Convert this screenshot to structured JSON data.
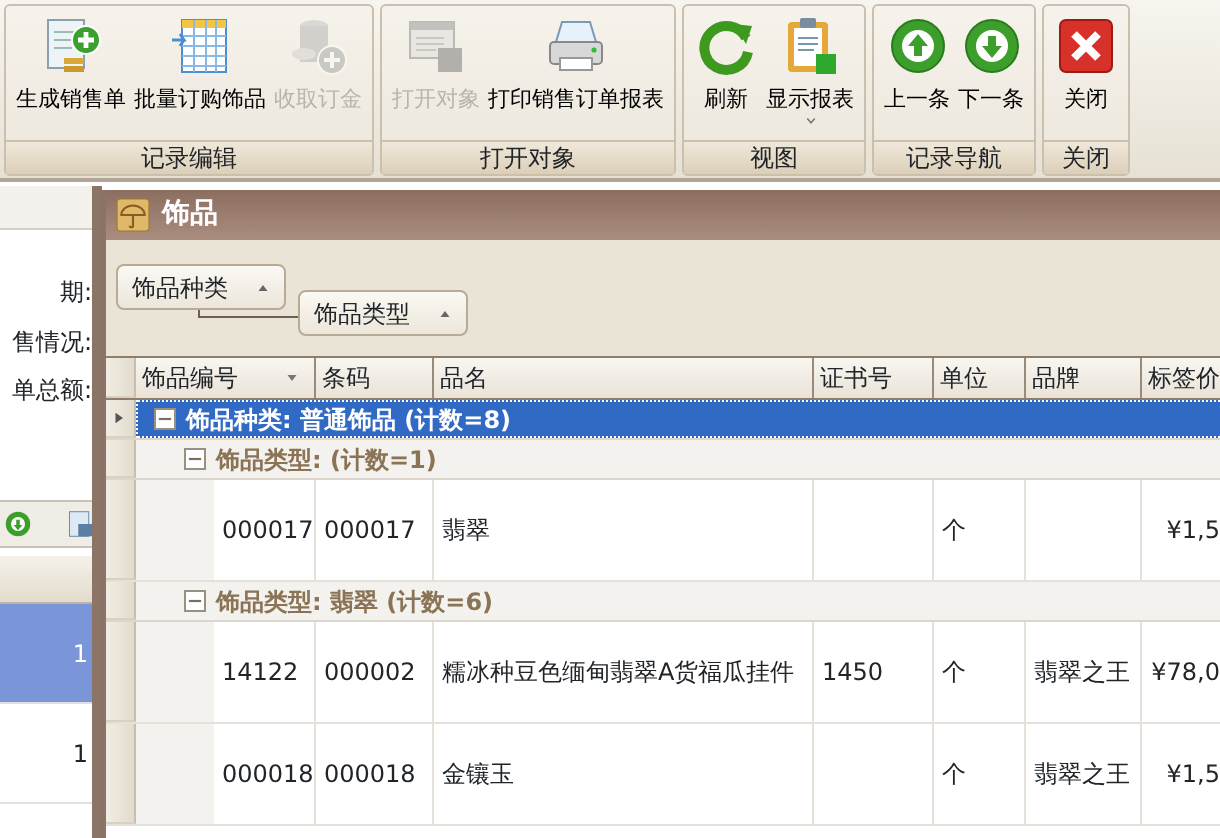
{
  "ribbon": {
    "groups": [
      {
        "label": "记录编辑",
        "buttons": [
          {
            "label": "生成销售单",
            "disabled": false
          },
          {
            "label": "批量订购饰品",
            "disabled": false
          },
          {
            "label": "收取订金",
            "disabled": true
          }
        ]
      },
      {
        "label": "打开对象",
        "buttons": [
          {
            "label": "打开对象",
            "disabled": true
          },
          {
            "label": "打印销售订单报表",
            "disabled": false
          }
        ]
      },
      {
        "label": "视图",
        "buttons": [
          {
            "label": "刷新",
            "disabled": false
          },
          {
            "label": "显示报表",
            "disabled": false,
            "has_menu": true
          }
        ]
      },
      {
        "label": "记录导航",
        "buttons": [
          {
            "label": "上一条",
            "disabled": false
          },
          {
            "label": "下一条",
            "disabled": false
          }
        ]
      },
      {
        "label": "关闭",
        "buttons": [
          {
            "label": "关闭",
            "disabled": false
          }
        ]
      }
    ]
  },
  "form": {
    "labels": [
      "期:",
      "售情况:",
      "单总额:"
    ]
  },
  "list": {
    "rows": [
      {
        "value": "1",
        "selected": true
      },
      {
        "value": "1",
        "selected": false
      }
    ]
  },
  "window": {
    "title": "饰品",
    "group_panel": [
      {
        "label": "饰品种类",
        "ascending": true
      },
      {
        "label": "饰品类型",
        "ascending": true
      }
    ],
    "table": {
      "columns": [
        {
          "label": "饰品编号",
          "ascending": false
        },
        {
          "label": "条码"
        },
        {
          "label": "品名"
        },
        {
          "label": "证书号"
        },
        {
          "label": "单位"
        },
        {
          "label": "品牌"
        },
        {
          "label": "标签价"
        }
      ],
      "groups": [
        {
          "label": "饰品种类: 普通饰品 (计数=8)",
          "selected": true,
          "expanded": true,
          "children": [
            {
              "label": "饰品类型: (计数=1)",
              "selected": false,
              "expanded": true,
              "rows": [
                [
                  "000017",
                  "000017",
                  "翡翠",
                  null,
                  "个",
                  null,
                  "¥1,5"
                ]
              ]
            },
            {
              "label": "饰品类型: 翡翠 (计数=6)",
              "selected": false,
              "expanded": true,
              "rows": [
                [
                  "14122",
                  "000002",
                  "糯冰种豆色缅甸翡翠A货福瓜挂件",
                  "1450",
                  "个",
                  "翡翠之王",
                  "¥78,0"
                ],
                [
                  "000018",
                  "000018",
                  "金镶玉",
                  null,
                  "个",
                  "翡翠之王",
                  "¥1,5"
                ]
              ]
            }
          ]
        }
      ]
    }
  }
}
